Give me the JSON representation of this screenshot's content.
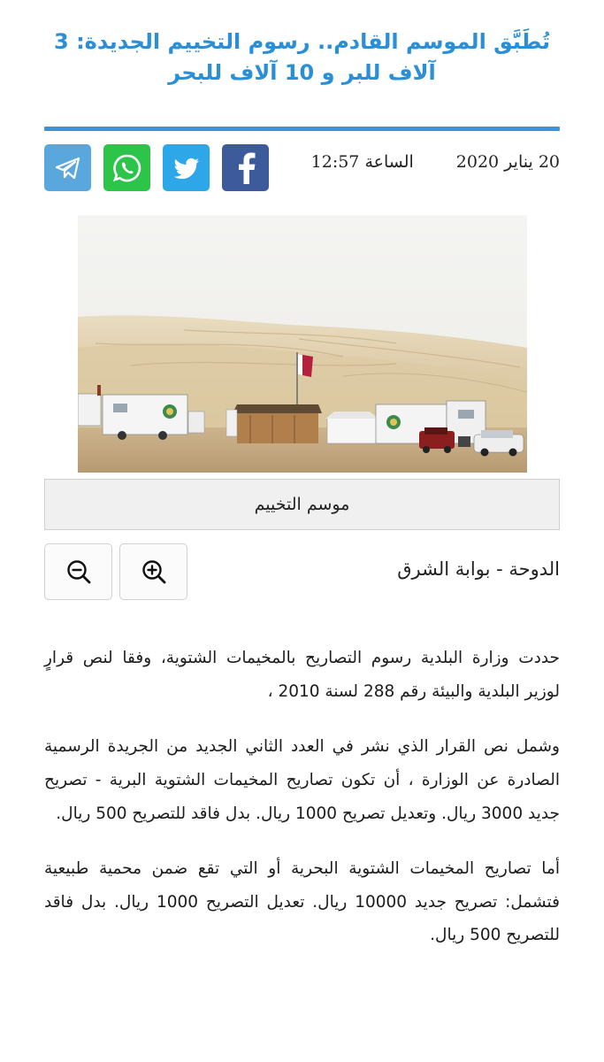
{
  "article": {
    "headline": "تُطَبَّق الموسم القادم.. رسوم التخييم الجديدة: 3 آلاف للبر و 10 آلاف للبحر",
    "date": "20 يناير 2020",
    "time": "الساعة 12:57",
    "image_caption": "موسم التخييم",
    "source": "الدوحة - بوابة الشرق",
    "paragraphs": [
      "حددت وزارة البلدية رسوم التصاريح بالمخيمات الشتوية، وفقا لنص قرارٍ لوزير البلدية والبيئة رقم 288 لسنة 2010 ،",
      "وشمل نص القرار الذي نشر في العدد الثاني الجديد من الجريدة الرسمية الصادرة عن الوزارة ، أن تكون تصاريح المخيمات الشتوية البرية - تصريح جديد 3000 ريال. وتعديل تصريح 1000 ريال. بدل فاقد للتصريح 500 ريال.",
      "أما تصاريح المخيمات الشتوية البحرية أو التي تقع ضمن محمية طبيعية فتشمل: تصريح جديد 10000 ريال. تعديل التصريح 1000 ريال. بدل فاقد للتصريح 500 ريال."
    ]
  },
  "share": {
    "buttons": [
      {
        "id": "telegram",
        "icon": "telegram-icon",
        "color": "#5aa7dd"
      },
      {
        "id": "whatsapp",
        "icon": "whatsapp-icon",
        "color": "#2dc44a"
      },
      {
        "id": "twitter",
        "icon": "twitter-icon",
        "color": "#2da7e7"
      },
      {
        "id": "facebook",
        "icon": "facebook-icon",
        "color": "#3d5a9a"
      }
    ]
  },
  "zoom": {
    "out_icon": "zoom-out-icon",
    "in_icon": "zoom-in-icon"
  },
  "theme": {
    "accent": "#3c93d8",
    "headline_color": "#2a8fd6"
  }
}
